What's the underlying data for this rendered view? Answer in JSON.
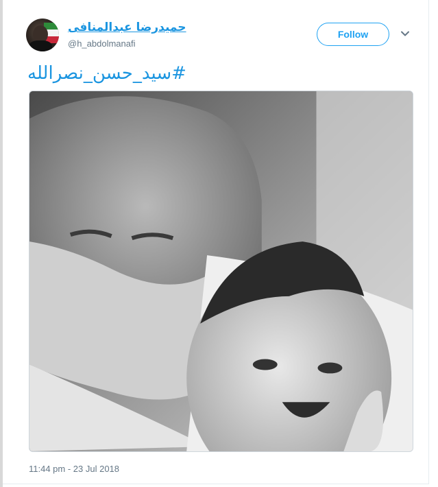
{
  "tweet": {
    "display_name": "حمیدرضا عبدالمنافی",
    "handle": "@h_abdolmanafi",
    "follow_label": "Follow",
    "hashtag_text": "#سید_حسن_نصرالله",
    "timestamp": "11:44 pm - 23 Jul 2018"
  },
  "icons": {
    "more": "chevron-down-icon",
    "avatar": "avatar"
  },
  "colors": {
    "link_blue": "#1b95e0",
    "follow_blue": "#1da1f2",
    "meta_gray": "#657786",
    "border": "#e6ecf0"
  }
}
